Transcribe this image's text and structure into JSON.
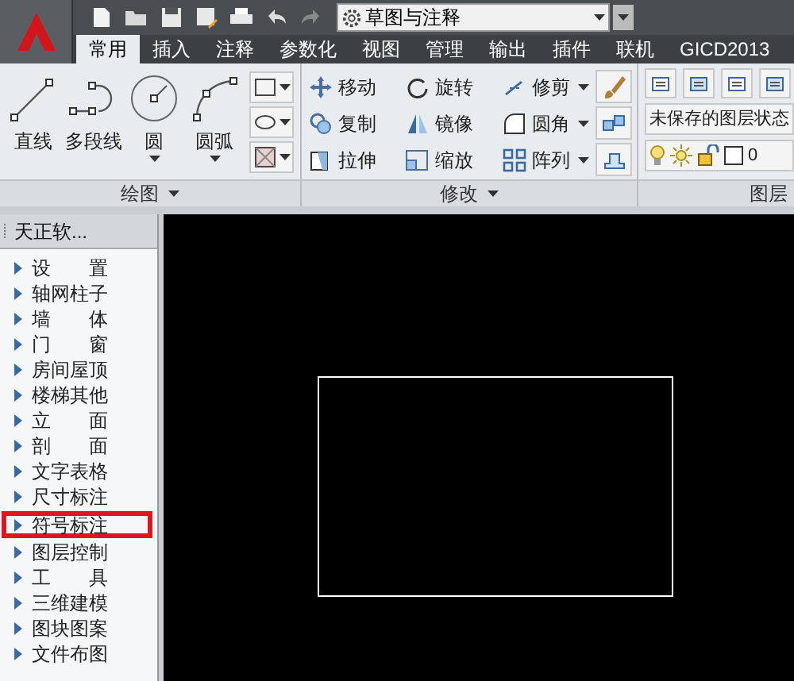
{
  "quick_access": {
    "workspace": "草图与注释"
  },
  "tabs": [
    {
      "label": "常用",
      "selected": true
    },
    {
      "label": "插入",
      "selected": false
    },
    {
      "label": "注释",
      "selected": false
    },
    {
      "label": "参数化",
      "selected": false
    },
    {
      "label": "视图",
      "selected": false
    },
    {
      "label": "管理",
      "selected": false
    },
    {
      "label": "输出",
      "selected": false
    },
    {
      "label": "插件",
      "selected": false
    },
    {
      "label": "联机",
      "selected": false
    },
    {
      "label": "GICD2013",
      "selected": false
    }
  ],
  "draw_panel": {
    "title": "绘图",
    "tools": [
      {
        "label": "直线",
        "dropdown": false
      },
      {
        "label": "多段线",
        "dropdown": false
      },
      {
        "label": "圆",
        "dropdown": true
      },
      {
        "label": "圆弧",
        "dropdown": true
      }
    ]
  },
  "modify_panel": {
    "title": "修改",
    "tools": [
      {
        "label": "移动",
        "dropdown": false
      },
      {
        "label": "复制",
        "dropdown": false
      },
      {
        "label": "拉伸",
        "dropdown": false
      },
      {
        "label": "旋转",
        "dropdown": false
      },
      {
        "label": "镜像",
        "dropdown": false
      },
      {
        "label": "缩放",
        "dropdown": false
      },
      {
        "label": "修剪",
        "dropdown": true
      },
      {
        "label": "圆角",
        "dropdown": true
      },
      {
        "label": "阵列",
        "dropdown": true
      }
    ]
  },
  "layer_panel": {
    "title": "图层",
    "layer_state": "未保存的图层状态",
    "current_layer": "0"
  },
  "palette": {
    "title": "天正软...",
    "items": [
      {
        "label": "设　　置",
        "selected": false
      },
      {
        "label": "轴网柱子",
        "selected": false
      },
      {
        "label": "墙　　体",
        "selected": false
      },
      {
        "label": "门　　窗",
        "selected": false
      },
      {
        "label": "房间屋顶",
        "selected": false
      },
      {
        "label": "楼梯其他",
        "selected": false
      },
      {
        "label": "立　　面",
        "selected": false
      },
      {
        "label": "剖　　面",
        "selected": false
      },
      {
        "label": "文字表格",
        "selected": false
      },
      {
        "label": "尺寸标注",
        "selected": false
      },
      {
        "label": "符号标注",
        "selected": true
      },
      {
        "label": "图层控制",
        "selected": false
      },
      {
        "label": "工　　具",
        "selected": false
      },
      {
        "label": "三维建模",
        "selected": false
      },
      {
        "label": "图块图案",
        "selected": false
      },
      {
        "label": "文件布图",
        "selected": false
      }
    ]
  }
}
